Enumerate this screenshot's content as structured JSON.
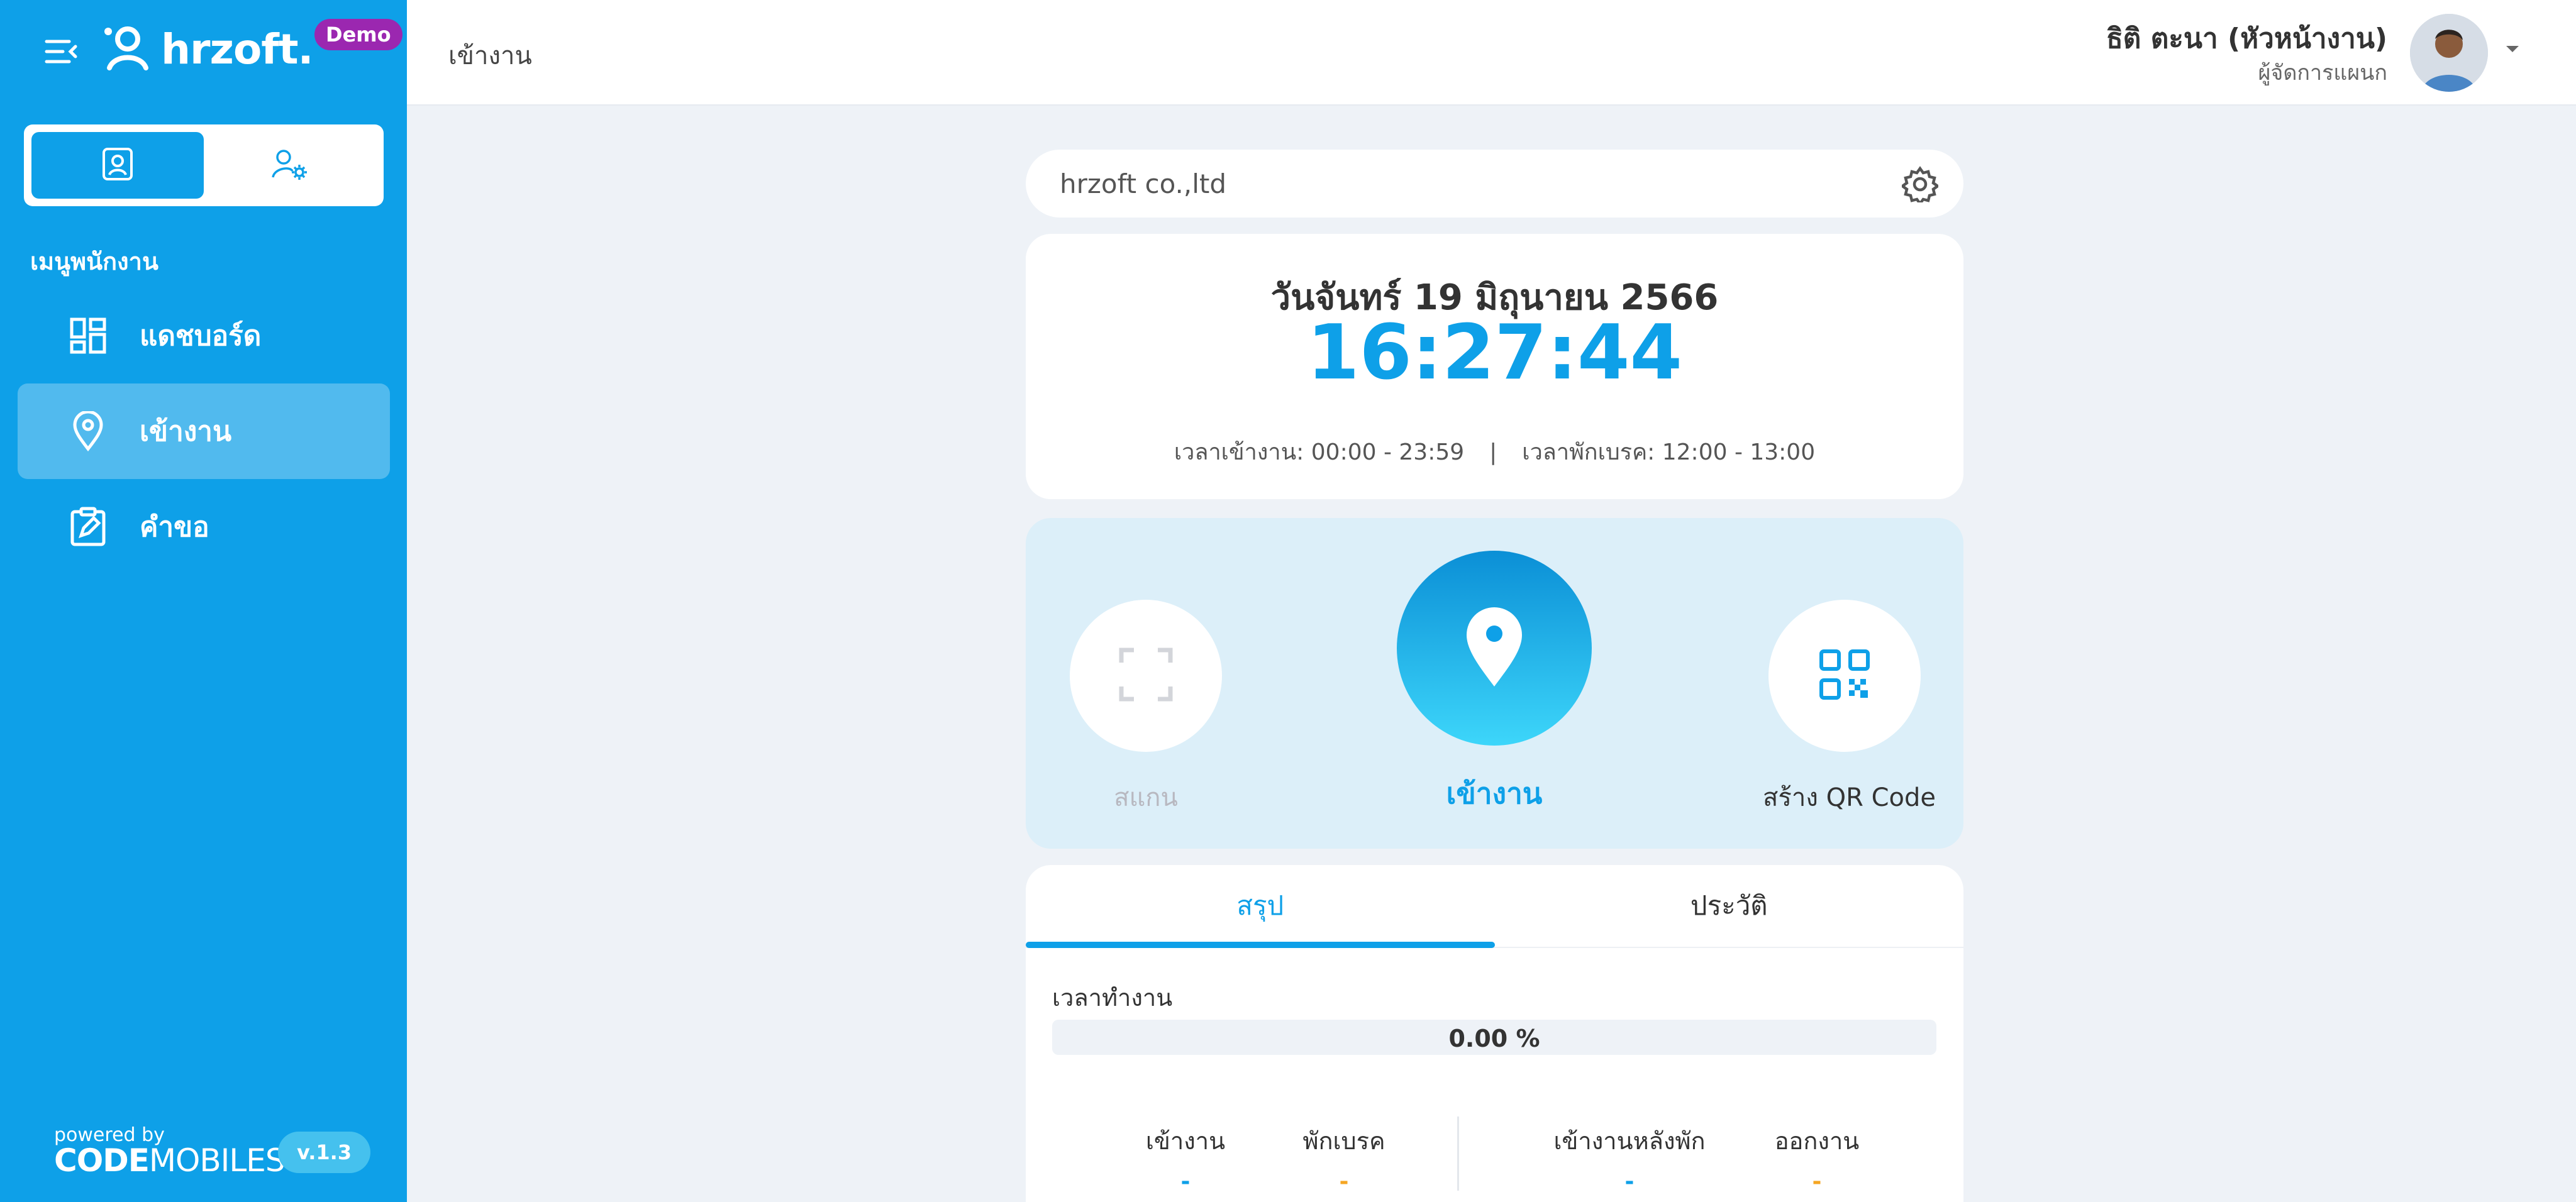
{
  "app": {
    "logo_text": "hrzoft.",
    "demo_badge": "Demo"
  },
  "sidebar": {
    "menu_heading": "เมนูพนักงาน",
    "items": [
      {
        "label": "แดชบอร์ด",
        "icon": "dashboard-icon",
        "active": false
      },
      {
        "label": "เข้างาน",
        "icon": "location-pin-icon",
        "active": true
      },
      {
        "label": "คำขอ",
        "icon": "request-edit-icon",
        "active": false
      }
    ],
    "powered_by": "powered by",
    "brand_code": "CODE",
    "brand_mobiles": "MOBILES",
    "version": "v.1.3"
  },
  "header": {
    "page_title": "เข้างาน",
    "user_name": "ธิติ ตะนา (หัวหน้างาน)",
    "user_role": "ผู้จัดการแผนก"
  },
  "company": {
    "name": "hrzoft co.,ltd"
  },
  "clock": {
    "date": "วันจันทร์ 19 มิถุนายน 2566",
    "time": "16:27:44",
    "work_hours": "เวลาเข้างาน: 00:00 - 23:59",
    "separator": "|",
    "break_hours": "เวลาพักเบรค: 12:00 - 13:00"
  },
  "actions": {
    "scan": "สแกน",
    "check_in": "เข้างาน",
    "create_qr": "สร้าง QR Code"
  },
  "summary": {
    "tabs": [
      "สรุป",
      "ประวัติ"
    ],
    "active_tab": 0,
    "worktime_label": "เวลาทำงาน",
    "progress_percent": 0,
    "progress_text": "0.00 %",
    "stats": [
      {
        "label": "เข้างาน",
        "value": "-"
      },
      {
        "label": "พักเบรค",
        "value": "-"
      },
      {
        "label": "เข้างานหลังพัก",
        "value": "-"
      },
      {
        "label": "ออกงาน",
        "value": "-"
      }
    ]
  },
  "colors": {
    "primary": "#0ea0e8",
    "sidebar_bg": "#0ea0e8",
    "demo_badge": "#9b27b0",
    "orange": "#f5a623",
    "page_bg": "#eef2f7"
  }
}
